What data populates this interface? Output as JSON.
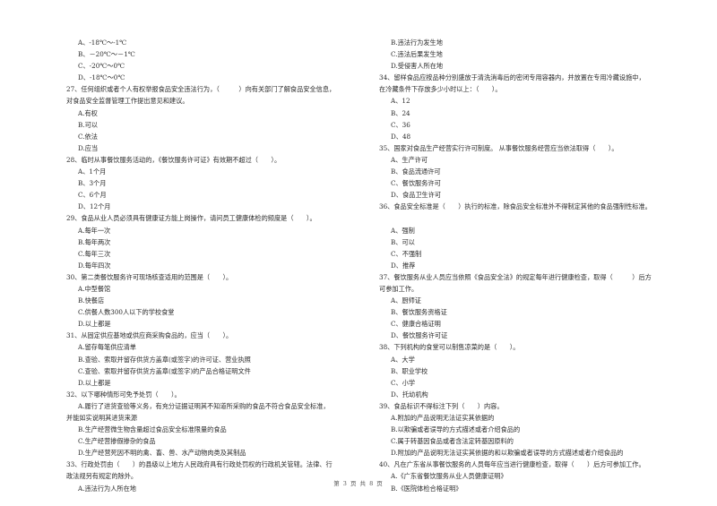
{
  "document": {
    "left_column": [
      {
        "type": "opt",
        "text": "A、-18℃～-1℃"
      },
      {
        "type": "opt",
        "text": "B、－20℃～－1℃"
      },
      {
        "type": "opt",
        "text": "C、-20℃～0℃"
      },
      {
        "type": "opt",
        "text": "D、-18℃～0℃"
      },
      {
        "type": "q",
        "text": "27、任何组织或者个人有权举报食品安全违法行为，（　　　）向有关部门了解食品安全信息，"
      },
      {
        "type": "cont",
        "text": "对食品安全监督管理工作提出意见和建议。"
      },
      {
        "type": "opt",
        "text": "A.有权"
      },
      {
        "type": "opt",
        "text": "B.可以"
      },
      {
        "type": "opt",
        "text": "C.依法"
      },
      {
        "type": "opt",
        "text": "D.应当"
      },
      {
        "type": "q",
        "text": "28、临时从事餐饮服务活动的，《餐饮服务许可证》有效期不超过（　　）。"
      },
      {
        "type": "opt",
        "text": "A、1个月"
      },
      {
        "type": "opt",
        "text": "B、3个月"
      },
      {
        "type": "opt",
        "text": "C、6个月"
      },
      {
        "type": "opt",
        "text": "D、12个月"
      },
      {
        "type": "q",
        "text": "29、食品从业人员必须具有健康证方能上岗操作，请问员工健康体检的频度是（　　）。"
      },
      {
        "type": "opt",
        "text": "A.每年一次"
      },
      {
        "type": "opt",
        "text": "B.每年两次"
      },
      {
        "type": "opt",
        "text": "C.每年三次"
      },
      {
        "type": "opt",
        "text": "D.每年四次"
      },
      {
        "type": "q",
        "text": "30、第二类餐饮服务许可现场核查适用的范围是（　　）。"
      },
      {
        "type": "opt",
        "text": "A.中型餐馆"
      },
      {
        "type": "opt",
        "text": "B.快餐店"
      },
      {
        "type": "opt",
        "text": "C.供餐人数300人以下的学校食堂"
      },
      {
        "type": "opt",
        "text": "D.以上都是"
      },
      {
        "type": "q",
        "text": "31、从固定供应基地或供应商采购食品的，应当（　　）。"
      },
      {
        "type": "opt",
        "text": "A.留存每笔供应清单"
      },
      {
        "type": "opt",
        "text": "B.查验、索取并留存供货方盖章(或签字)的许可证、营业执照"
      },
      {
        "type": "opt",
        "text": "C.查验、索取并留存供货方盖章(或签字)的产品合格证明文件"
      },
      {
        "type": "opt",
        "text": "D.以上都是"
      },
      {
        "type": "q",
        "text": "32、以下哪种情形可免予处罚（　　）。"
      },
      {
        "type": "opt",
        "text": "A.履行了进货查验等义务，有充分证据证明其不知道所采购的食品不符合食品安全标准，"
      },
      {
        "type": "cont",
        "text": "并能如实说明其进货来源"
      },
      {
        "type": "opt",
        "text": "B.生产经营微生物含量超过食品安全标准限量的食品"
      },
      {
        "type": "opt",
        "text": "C.生产经营掺假掺杂的食品"
      },
      {
        "type": "opt",
        "text": "D.生产经营死因不明的禽、畜、兽、水产动物肉类及其制品"
      },
      {
        "type": "q",
        "text": "33、行政处罚由（　　）的县级以上地方人民政府具有行政处罚权的行政机关管辖。法律、行"
      },
      {
        "type": "cont",
        "text": "政法规另有规定的除外。"
      },
      {
        "type": "opt",
        "text": "A.违法行为人所在地"
      }
    ],
    "right_column": [
      {
        "type": "opt",
        "text": "B.违法行为发生地"
      },
      {
        "type": "opt",
        "text": "C.违法后果发生地"
      },
      {
        "type": "opt",
        "text": "D.受侵害人所在地"
      },
      {
        "type": "q",
        "text": "34、留样食品应按品种分别盛放于清洗消毒后的密闭专用容器内，并放置在专用冷藏设施中，"
      },
      {
        "type": "cont",
        "text": "在冷藏条件下存放多少小时以上：（　　）。"
      },
      {
        "type": "opt",
        "text": "A、12"
      },
      {
        "type": "opt",
        "text": "B、24"
      },
      {
        "type": "opt",
        "text": "C、36"
      },
      {
        "type": "opt",
        "text": "D、48"
      },
      {
        "type": "q",
        "text": "35、国家对食品生产经营实行许可制度。 从事餐饮服务经营应当依法取得（　　）。"
      },
      {
        "type": "opt",
        "text": "A、生产许可"
      },
      {
        "type": "opt",
        "text": "B、食品流通许可"
      },
      {
        "type": "opt",
        "text": "C、餐饮服务许可"
      },
      {
        "type": "opt",
        "text": "D、食品卫生许可"
      },
      {
        "type": "q",
        "text": "36、食品安全标准是（　　）执行的标准，除食品安全标准外不得制定其他的食品强制性标准。"
      },
      {
        "type": "gap",
        "text": ""
      },
      {
        "type": "opt",
        "text": "A、强制"
      },
      {
        "type": "opt",
        "text": "B、可以"
      },
      {
        "type": "opt",
        "text": "C、不强制"
      },
      {
        "type": "opt",
        "text": "D、推荐"
      },
      {
        "type": "q",
        "text": "37、餐饮服务从业人员应当依照《食品安全法》的规定每年进行健康检查，取得（　　　）后方"
      },
      {
        "type": "cont",
        "text": "可参加工作。"
      },
      {
        "type": "opt",
        "text": "A、厨师证"
      },
      {
        "type": "opt",
        "text": "B、餐饮服务资格证"
      },
      {
        "type": "opt",
        "text": "C、健康合格证明"
      },
      {
        "type": "opt",
        "text": "D、餐饮服务许可证"
      },
      {
        "type": "q",
        "text": "38、下列机构的食堂可以制售凉菜的是（　　）。"
      },
      {
        "type": "opt",
        "text": "A、大学"
      },
      {
        "type": "opt",
        "text": "B、职业学校"
      },
      {
        "type": "opt",
        "text": "C、小学"
      },
      {
        "type": "opt",
        "text": "D、托幼机构"
      },
      {
        "type": "q",
        "text": "39、食品标识不得标注下列（　　）内容。"
      },
      {
        "type": "opt",
        "text": "A.附加的产品说明无法证实其依据的"
      },
      {
        "type": "opt",
        "text": "B.以欺骗或者误导的方式描述或者介绍食品的"
      },
      {
        "type": "opt",
        "text": "C.属于转基因食品或者含法定转基因原料的"
      },
      {
        "type": "opt",
        "text": "D.附加的产品说明无法证实其依据的和以欺骗或者误导的方式描述或者介绍食品的"
      },
      {
        "type": "q",
        "text": "40、凡在广东省从事餐饮服务的人员每年应当进行健康检查，取得（　　）后方可参加工作。"
      },
      {
        "type": "opt",
        "text": "A.《广东省餐饮服务从业人员健康证明》"
      },
      {
        "type": "opt",
        "text": "B.《医院体检合格证明》"
      }
    ],
    "footer": "第 3 页 共 8 页"
  }
}
